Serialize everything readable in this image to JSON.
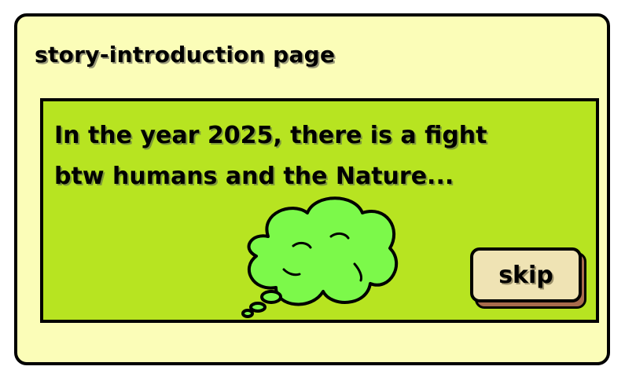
{
  "page": {
    "title": "story-introduction page"
  },
  "story": {
    "text": "In the year 2025, there is a fight btw humans and the Nature..."
  },
  "thought_bubble": {
    "icon": "thought-cloud-icon",
    "color": "#7cf94a"
  },
  "skip_button": {
    "label": "skip"
  },
  "colors": {
    "frame_background": "#fbfdb8",
    "story_panel_background": "#b7e421",
    "skip_face": "#efe3b4",
    "skip_shadow": "#a86b4c"
  }
}
